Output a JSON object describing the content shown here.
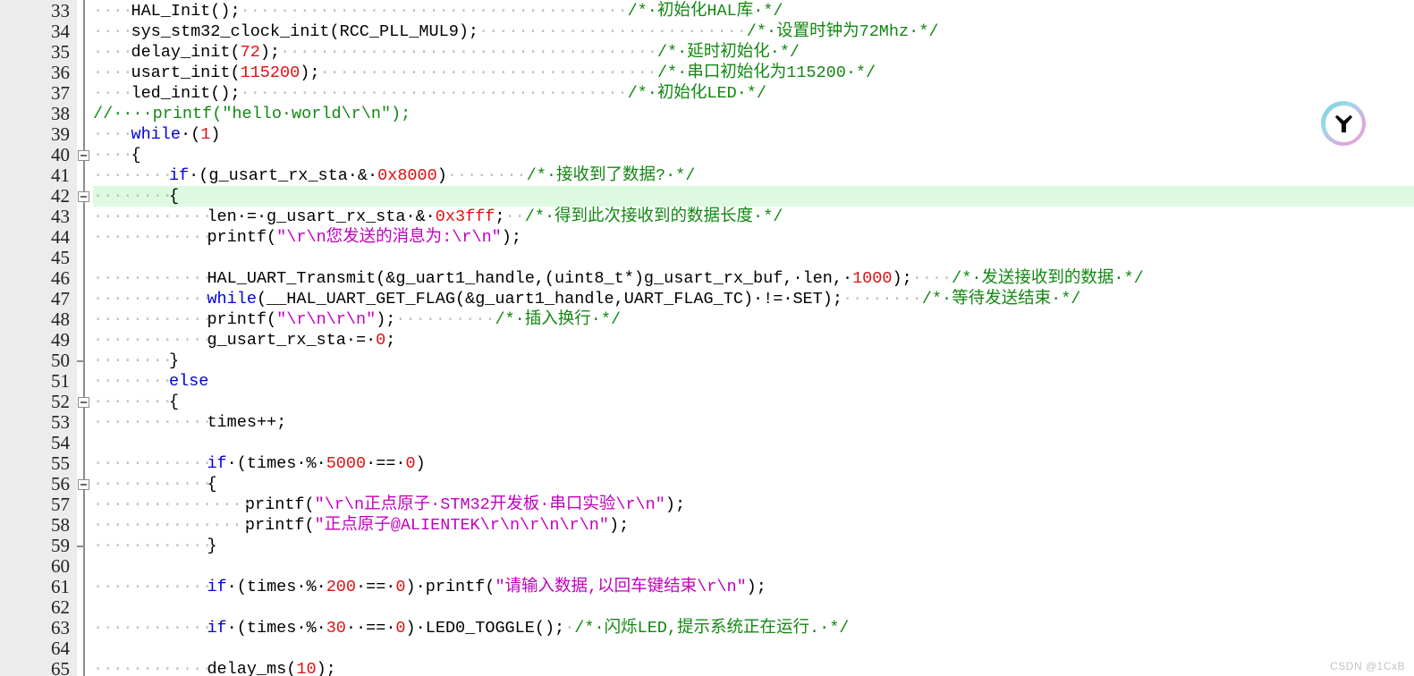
{
  "app": {
    "type": "code-editor",
    "language": "C",
    "watermark": "CSDN @1CxB"
  },
  "colors": {
    "gutter_bg": "#ececec",
    "editor_bg": "#ffffff",
    "current_line_highlight": "#ddfae1",
    "keyword": "#0000dd",
    "number": "#e01010",
    "string": "#c000c0",
    "comment": "#118811",
    "plain": "#000000",
    "whitespace_dot": "#bfbfbf",
    "fold_line": "#8c8c8c"
  },
  "logo": {
    "name": "trae-ai-circle-logo",
    "ring_start": "#6ed2e8",
    "ring_end": "#f0a8d0"
  },
  "gutter": {
    "first_line": 33,
    "last_line": 65,
    "fold_open_lines": [
      40,
      42,
      52,
      56
    ],
    "fold_end_lines": [
      50,
      59
    ]
  },
  "highlighted_line": 42,
  "lines": [
    {
      "n": 33,
      "indent": 4,
      "tokens": [
        {
          "t": "plain",
          "v": "HAL_Init();"
        },
        {
          "t": "ws",
          "v": "·······································"
        },
        {
          "t": "cmt",
          "v": "/*·初始化HAL库·*/"
        }
      ]
    },
    {
      "n": 34,
      "indent": 4,
      "tokens": [
        {
          "t": "plain",
          "v": "sys_stm32_clock_init(RCC_PLL_MUL9);"
        },
        {
          "t": "ws",
          "v": "···························"
        },
        {
          "t": "cmt",
          "v": "/*·设置时钟为72Mhz·*/"
        }
      ]
    },
    {
      "n": 35,
      "indent": 4,
      "tokens": [
        {
          "t": "plain",
          "v": "delay_init("
        },
        {
          "t": "num",
          "v": "72"
        },
        {
          "t": "plain",
          "v": ");"
        },
        {
          "t": "ws",
          "v": "······································"
        },
        {
          "t": "cmt",
          "v": "/*·延时初始化·*/"
        }
      ]
    },
    {
      "n": 36,
      "indent": 4,
      "tokens": [
        {
          "t": "plain",
          "v": "usart_init("
        },
        {
          "t": "num",
          "v": "115200"
        },
        {
          "t": "plain",
          "v": ");"
        },
        {
          "t": "ws",
          "v": "··································"
        },
        {
          "t": "cmt",
          "v": "/*·串口初始化为115200·*/"
        }
      ]
    },
    {
      "n": 37,
      "indent": 4,
      "tokens": [
        {
          "t": "plain",
          "v": "led_init();"
        },
        {
          "t": "ws",
          "v": "·······································"
        },
        {
          "t": "cmt",
          "v": "/*·初始化LED·*/"
        }
      ]
    },
    {
      "n": 38,
      "indent": 0,
      "tokens": [
        {
          "t": "cmt",
          "v": "//····printf(\"hello·world\\r\\n\");"
        }
      ]
    },
    {
      "n": 39,
      "indent": 4,
      "tokens": [
        {
          "t": "kw",
          "v": "while"
        },
        {
          "t": "plain",
          "v": "·("
        },
        {
          "t": "num",
          "v": "1"
        },
        {
          "t": "plain",
          "v": ")"
        }
      ]
    },
    {
      "n": 40,
      "indent": 4,
      "fold": "open",
      "tokens": [
        {
          "t": "plain",
          "v": "{"
        }
      ]
    },
    {
      "n": 41,
      "indent": 8,
      "tokens": [
        {
          "t": "kw",
          "v": "if"
        },
        {
          "t": "plain",
          "v": "·(g_usart_rx_sta·&·"
        },
        {
          "t": "num",
          "v": "0x8000"
        },
        {
          "t": "plain",
          "v": ")"
        },
        {
          "t": "ws",
          "v": "········"
        },
        {
          "t": "cmt",
          "v": "/*·接收到了数据?·*/"
        }
      ]
    },
    {
      "n": 42,
      "indent": 8,
      "fold": "open",
      "highlight": true,
      "tokens": [
        {
          "t": "plain",
          "v": "{"
        }
      ]
    },
    {
      "n": 43,
      "indent": 12,
      "tokens": [
        {
          "t": "plain",
          "v": "len·=·g_usart_rx_sta·&·"
        },
        {
          "t": "num",
          "v": "0x3fff"
        },
        {
          "t": "plain",
          "v": ";"
        },
        {
          "t": "ws",
          "v": "··"
        },
        {
          "t": "cmt",
          "v": "/*·得到此次接收到的数据长度·*/"
        }
      ]
    },
    {
      "n": 44,
      "indent": 12,
      "tokens": [
        {
          "t": "plain",
          "v": "printf("
        },
        {
          "t": "str",
          "v": "\"\\r\\n您发送的消息为:\\r\\n\""
        },
        {
          "t": "plain",
          "v": ");"
        }
      ]
    },
    {
      "n": 45,
      "indent": 0,
      "tokens": []
    },
    {
      "n": 46,
      "indent": 12,
      "tokens": [
        {
          "t": "plain",
          "v": "HAL_UART_Transmit(&g_uart1_handle,(uint8_t*)g_usart_rx_buf,·len,·"
        },
        {
          "t": "num",
          "v": "1000"
        },
        {
          "t": "plain",
          "v": ");"
        },
        {
          "t": "ws",
          "v": "····"
        },
        {
          "t": "cmt",
          "v": "/*·发送接收到的数据·*/"
        }
      ]
    },
    {
      "n": 47,
      "indent": 12,
      "tokens": [
        {
          "t": "kw",
          "v": "while"
        },
        {
          "t": "plain",
          "v": "(__HAL_UART_GET_FLAG(&g_uart1_handle,UART_FLAG_TC)·!=·SET);"
        },
        {
          "t": "ws",
          "v": "········"
        },
        {
          "t": "cmt",
          "v": "/*·等待发送结束·*/"
        }
      ]
    },
    {
      "n": 48,
      "indent": 12,
      "tokens": [
        {
          "t": "plain",
          "v": "printf("
        },
        {
          "t": "str",
          "v": "\"\\r\\n\\r\\n\""
        },
        {
          "t": "plain",
          "v": ");"
        },
        {
          "t": "ws",
          "v": "··········"
        },
        {
          "t": "cmt",
          "v": "/*·插入换行·*/"
        }
      ]
    },
    {
      "n": 49,
      "indent": 12,
      "tokens": [
        {
          "t": "plain",
          "v": "g_usart_rx_sta·=·"
        },
        {
          "t": "num",
          "v": "0"
        },
        {
          "t": "plain",
          "v": ";"
        }
      ]
    },
    {
      "n": 50,
      "indent": 8,
      "fold": "end",
      "tokens": [
        {
          "t": "plain",
          "v": "}"
        }
      ]
    },
    {
      "n": 51,
      "indent": 8,
      "tokens": [
        {
          "t": "kw",
          "v": "else"
        }
      ]
    },
    {
      "n": 52,
      "indent": 8,
      "fold": "open",
      "tokens": [
        {
          "t": "plain",
          "v": "{"
        }
      ]
    },
    {
      "n": 53,
      "indent": 12,
      "tokens": [
        {
          "t": "plain",
          "v": "times++;"
        }
      ]
    },
    {
      "n": 54,
      "indent": 0,
      "tokens": []
    },
    {
      "n": 55,
      "indent": 12,
      "tokens": [
        {
          "t": "kw",
          "v": "if"
        },
        {
          "t": "plain",
          "v": "·(times·%·"
        },
        {
          "t": "num",
          "v": "5000"
        },
        {
          "t": "plain",
          "v": "·==·"
        },
        {
          "t": "num",
          "v": "0"
        },
        {
          "t": "plain",
          "v": ")"
        }
      ]
    },
    {
      "n": 56,
      "indent": 12,
      "fold": "open",
      "tokens": [
        {
          "t": "plain",
          "v": "{"
        }
      ]
    },
    {
      "n": 57,
      "indent": 16,
      "tokens": [
        {
          "t": "plain",
          "v": "printf("
        },
        {
          "t": "str",
          "v": "\"\\r\\n正点原子·STM32开发板·串口实验\\r\\n\""
        },
        {
          "t": "plain",
          "v": ");"
        }
      ]
    },
    {
      "n": 58,
      "indent": 16,
      "tokens": [
        {
          "t": "plain",
          "v": "printf("
        },
        {
          "t": "str",
          "v": "\"正点原子@ALIENTEK\\r\\n\\r\\n\\r\\n\""
        },
        {
          "t": "plain",
          "v": ");"
        }
      ]
    },
    {
      "n": 59,
      "indent": 12,
      "fold": "end",
      "tokens": [
        {
          "t": "plain",
          "v": "}"
        }
      ]
    },
    {
      "n": 60,
      "indent": 0,
      "tokens": []
    },
    {
      "n": 61,
      "indent": 12,
      "tokens": [
        {
          "t": "kw",
          "v": "if"
        },
        {
          "t": "plain",
          "v": "·(times·%·"
        },
        {
          "t": "num",
          "v": "200"
        },
        {
          "t": "plain",
          "v": "·==·"
        },
        {
          "t": "num",
          "v": "0"
        },
        {
          "t": "plain",
          "v": ")·printf("
        },
        {
          "t": "str",
          "v": "\"请输入数据,以回车键结束\\r\\n\""
        },
        {
          "t": "plain",
          "v": ");"
        }
      ]
    },
    {
      "n": 62,
      "indent": 0,
      "tokens": []
    },
    {
      "n": 63,
      "indent": 12,
      "tokens": [
        {
          "t": "kw",
          "v": "if"
        },
        {
          "t": "plain",
          "v": "·(times·%·"
        },
        {
          "t": "num",
          "v": "30"
        },
        {
          "t": "plain",
          "v": "··==·"
        },
        {
          "t": "num",
          "v": "0"
        },
        {
          "t": "plain",
          "v": ")·LED0_TOGGLE();"
        },
        {
          "t": "ws",
          "v": "·"
        },
        {
          "t": "cmt",
          "v": "/*·闪烁LED,提示系统正在运行.·*/"
        }
      ]
    },
    {
      "n": 64,
      "indent": 0,
      "tokens": []
    },
    {
      "n": 65,
      "indent": 12,
      "tokens": [
        {
          "t": "plain",
          "v": "delay_ms("
        },
        {
          "t": "num",
          "v": "10"
        },
        {
          "t": "plain",
          "v": ");"
        }
      ]
    }
  ]
}
